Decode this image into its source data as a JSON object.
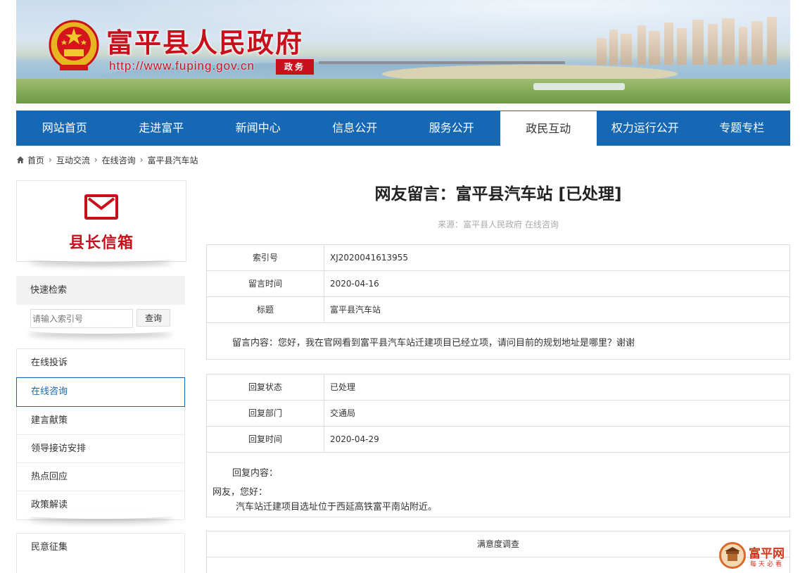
{
  "banner": {
    "title": "富平县人民政府",
    "url": "http://www.fuping.gov.cn",
    "tag": "政务"
  },
  "nav": {
    "items": [
      {
        "label": "网站首页"
      },
      {
        "label": "走进富平"
      },
      {
        "label": "新闻中心"
      },
      {
        "label": "信息公开"
      },
      {
        "label": "服务公开"
      },
      {
        "label": "政民互动",
        "active": true
      },
      {
        "label": "权力运行公开"
      },
      {
        "label": "专题专栏"
      }
    ]
  },
  "breadcrumb": {
    "items": [
      "首页",
      "互动交流",
      "在线咨询",
      "富平县汽车站"
    ]
  },
  "sidebar": {
    "mailbox_label": "县长信箱",
    "search_title": "快速检索",
    "search_placeholder": "请输入索引号",
    "search_button": "查询",
    "menu": [
      {
        "label": "在线投诉"
      },
      {
        "label": "在线咨询",
        "active": true
      },
      {
        "label": "建言献策"
      },
      {
        "label": "领导接访安排"
      },
      {
        "label": "热点回应"
      },
      {
        "label": "政策解读"
      }
    ],
    "menu2": [
      {
        "label": "民意征集"
      }
    ]
  },
  "message": {
    "title": "网友留言：富平县汽车站 [已处理]",
    "source": "来源：富平县人民政府 在线咨询",
    "index_label": "索引号",
    "index_value": "XJ2020041613955",
    "time_label": "留言时间",
    "time_value": "2020-04-16",
    "subject_label": "标题",
    "subject_value": "富平县汽车站",
    "content": "留言内容：您好，我在官网看到富平县汽车站迁建项目已经立项，请问目前的规划地址是哪里？谢谢"
  },
  "reply": {
    "status_label": "回复状态",
    "status_value": "已处理",
    "dept_label": "回复部门",
    "dept_value": "交通局",
    "time_label": "回复时间",
    "time_value": "2020-04-29",
    "content_label": "回复内容：",
    "greeting": "网友，您好：",
    "body": "汽车站迁建项目选址位于西延高铁富平南站附近。"
  },
  "survey": {
    "title": "满意度调查"
  },
  "corner": {
    "brand": "富平网",
    "slogan": "每天必看"
  },
  "colors": {
    "nav_blue": "#1667b4",
    "gov_red": "#c8101c"
  }
}
